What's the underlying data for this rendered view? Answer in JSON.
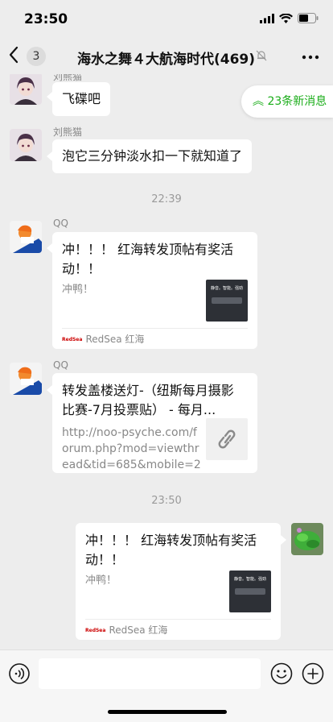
{
  "status_bar": {
    "time": "23:50"
  },
  "nav": {
    "back_count": "3",
    "title": "海水之舞４大航海时代(469)"
  },
  "new_messages": {
    "label": "23条新消息"
  },
  "messages": [
    {
      "sender": "刘熊猫",
      "text": "飞碟吧"
    },
    {
      "sender": "刘熊猫",
      "text": "泡它三分钟淡水扣一下就知道了"
    }
  ],
  "time_separators": [
    "22:39",
    "23:50"
  ],
  "cards": [
    {
      "sender": "QQ",
      "title": "冲！！！ 红海转发顶帖有奖活动！！",
      "desc": "冲鸭！",
      "thumb_text": "静音。智能。强劲",
      "source": "RedSea 红海"
    },
    {
      "sender": "QQ",
      "title": "转发盖楼送灯-（纽斯每月摄影比赛-7月投票贴） - 每月...",
      "desc": "http://noo-psyche.com/forum.php?mod=viewthread&tid=685&mobile=2",
      "thumb_icon": "link-icon"
    },
    {
      "title": "冲！！！ 红海转发顶帖有奖活动！！",
      "desc": "冲鸭！",
      "thumb_text": "静音。智能。强劲",
      "source": "RedSea 红海"
    }
  ],
  "source_logo": "RedSea",
  "colors": {
    "accent_green": "#1aad19",
    "background": "#ededed",
    "bubble": "#ffffff"
  }
}
